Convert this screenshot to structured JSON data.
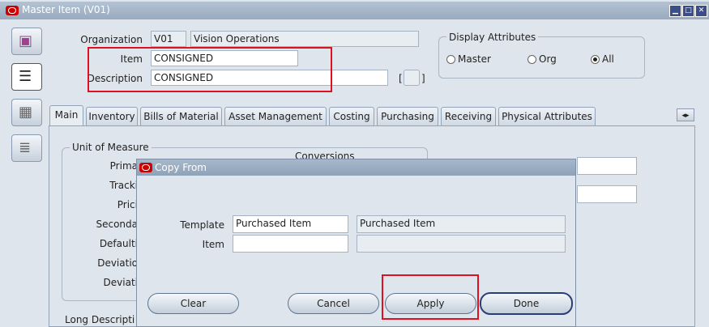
{
  "window": {
    "title": "Master Item (V01)"
  },
  "header": {
    "organization_label": "Organization",
    "organization_code": "V01",
    "organization_name": "Vision Operations",
    "item_label": "Item",
    "item_value": "CONSIGNED",
    "description_label": "Description",
    "description_value": "CONSIGNED",
    "bracket_open": "[",
    "bracket_close": "]"
  },
  "display_attributes": {
    "title": "Display Attributes",
    "options": [
      "Master",
      "Org",
      "All"
    ],
    "selected": "All"
  },
  "tabs": [
    "Main",
    "Inventory",
    "Bills of Material",
    "Asset Management",
    "Costing",
    "Purchasing",
    "Receiving",
    "Physical Attributes"
  ],
  "selected_tab": "Main",
  "main_panel": {
    "uom_group_title": "Unit of Measure",
    "conversions_title": "Conversions",
    "labels": [
      "Prima",
      "Tracki",
      "Prici",
      "Seconda",
      "Defaulti",
      "Deviatio",
      "Deviati"
    ],
    "long_description_label": "Long Descripti"
  },
  "dialog": {
    "title": "Copy From",
    "template_label": "Template",
    "template_value": "Purchased Item",
    "template_desc": "Purchased Item",
    "item_label": "Item",
    "item_value": "",
    "item_desc": "",
    "buttons": {
      "clear": "Clear",
      "cancel": "Cancel",
      "apply": "Apply",
      "done": "Done"
    }
  },
  "colors": {
    "highlight": "#d12",
    "oracle_red": "#cc0000",
    "title_blue": "#98aabf"
  }
}
